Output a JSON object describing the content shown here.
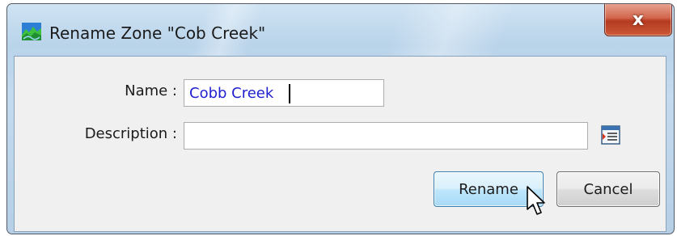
{
  "dialog": {
    "title": "Rename Zone \"Cob Creek\"",
    "app_icon": "watershed-icon",
    "close_icon": "close-icon",
    "close_glyph": "x"
  },
  "form": {
    "name_label": "Name :",
    "name_value": "Cobb Creek",
    "description_label": "Description :",
    "description_value": "",
    "browse_icon": "text-editor-icon"
  },
  "buttons": {
    "rename_label": "Rename",
    "cancel_label": "Cancel"
  },
  "cursor": {
    "icon": "mouse-pointer-icon"
  },
  "colors": {
    "name_text": "#1f1fcf",
    "rename_border": "#3c7fb1",
    "close_red": "#c4462b"
  }
}
